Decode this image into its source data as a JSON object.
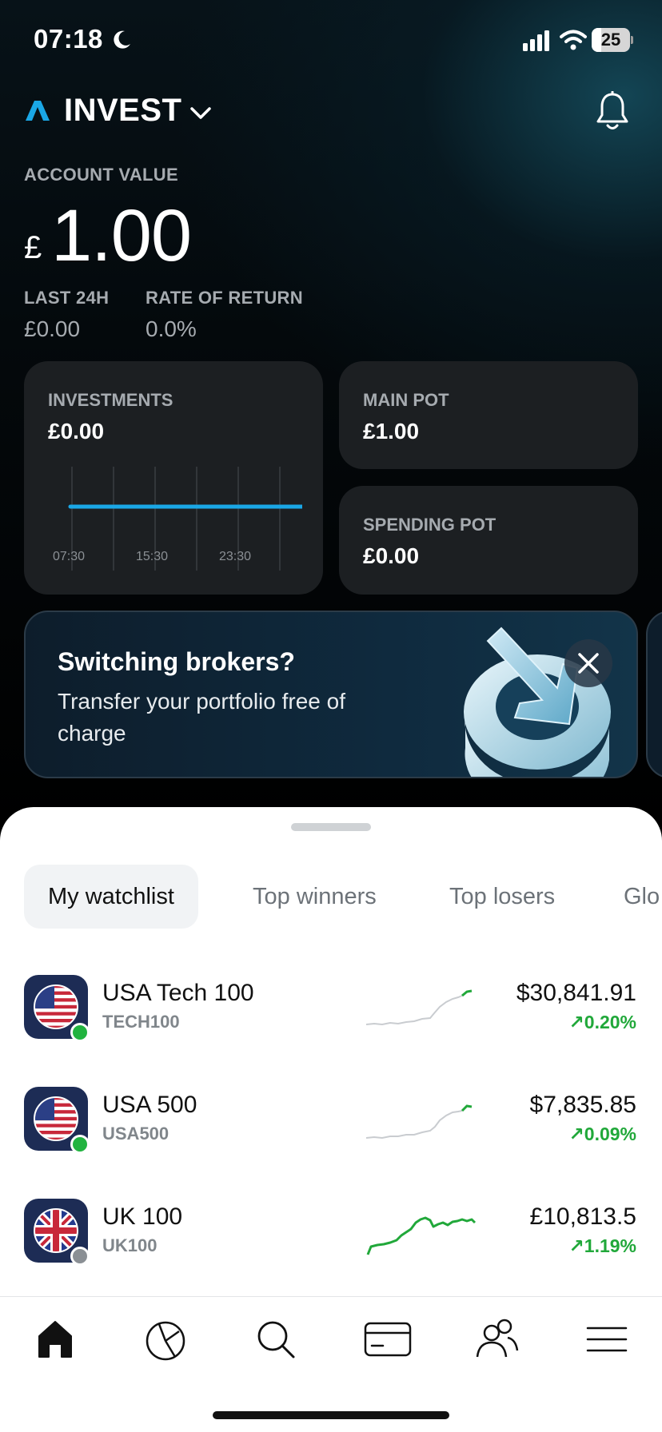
{
  "status_bar": {
    "time": "07:18",
    "battery": "25",
    "battery_level": 0.25
  },
  "header": {
    "title": "INVEST",
    "logo": "a-logo",
    "dropdown_icon": "chevron-down-icon",
    "notifications_icon": "bell-icon"
  },
  "account": {
    "label": "ACCOUNT VALUE",
    "currency": "£",
    "value": "1.00",
    "last24_label": "LAST 24H",
    "last24_value": "£0.00",
    "ror_label": "RATE OF RETURN",
    "ror_value": "0.0%"
  },
  "cards": {
    "investments": {
      "label": "INVESTMENTS",
      "value": "£0.00",
      "ticks": [
        "07:30",
        "15:30",
        "23:30"
      ]
    },
    "main_pot": {
      "label": "MAIN POT",
      "value": "£1.00"
    },
    "spending_pot": {
      "label": "SPENDING POT",
      "value": "£0.00"
    }
  },
  "banner": {
    "title": "Switching brokers?",
    "text": "Transfer your portfolio free of charge",
    "close_icon": "close-icon"
  },
  "tabs": [
    "My watchlist",
    "Top winners",
    "Top losers",
    "Glo"
  ],
  "active_tab": 0,
  "watchlist": [
    {
      "name": "USA Tech 100",
      "ticker": "TECH100",
      "price": "$30,841.91",
      "change": "↗0.20%",
      "market_open": true,
      "flag": "us-flag-icon"
    },
    {
      "name": "USA 500",
      "ticker": "USA500",
      "price": "$7,835.85",
      "change": "↗0.09%",
      "market_open": true,
      "flag": "us-flag-icon"
    },
    {
      "name": "UK 100",
      "ticker": "UK100",
      "price": "£10,813.5",
      "change": "↗1.19%",
      "market_open": false,
      "flag": "uk-flag-icon"
    }
  ],
  "colors": {
    "accent": "#1aa7e6",
    "positive": "#21a83a",
    "market_open_dot": "#21b33f",
    "market_closed_dot": "#8a8f94"
  },
  "nav": [
    "home-icon",
    "portfolio-icon",
    "search-icon",
    "card-icon",
    "community-icon",
    "menu-icon"
  ]
}
